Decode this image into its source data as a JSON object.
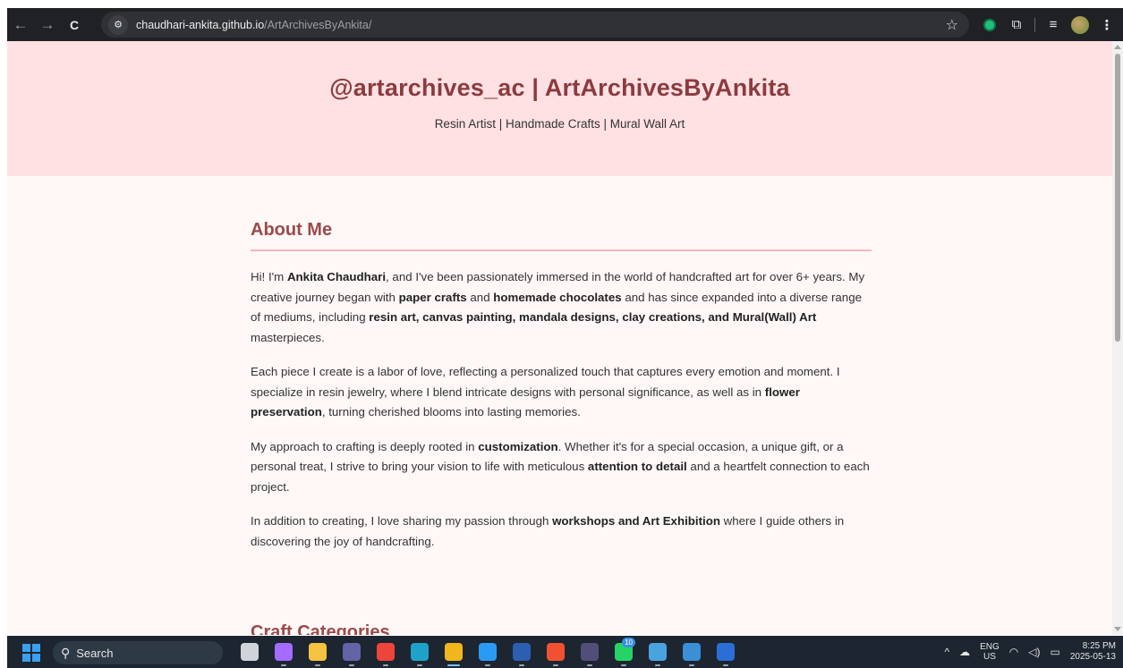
{
  "browser": {
    "back_icon": "←",
    "forward_icon": "→",
    "reload_icon": "C",
    "site_info_icon": "⚙",
    "url_domain": "chaudhari-ankita.github.io",
    "url_path": "/ArtArchivesByAnkita/",
    "star_icon": "☆",
    "extensions_icon": "⧉",
    "media_icon": "≡",
    "menu_icon": "⋮"
  },
  "hero": {
    "title": "@artarchives_ac | ArtArchivesByAnkita",
    "subtitle": "Resin Artist | Handmade Crafts | Mural Wall Art"
  },
  "about": {
    "heading": "About Me",
    "p1": {
      "t1": "Hi! I'm ",
      "b1": "Ankita Chaudhari",
      "t2": ", and I've been passionately immersed in the world of handcrafted art for over 6+ years. My creative journey began with ",
      "b2": "paper crafts",
      "t3": " and ",
      "b3": "homemade chocolates",
      "t4": " and has since expanded into a diverse range of mediums, including ",
      "b4": "resin art, canvas painting, mandala designs, clay creations, and Mural(Wall) Art",
      "t5": " masterpieces."
    },
    "p2": {
      "t1": "Each piece I create is a labor of love, reflecting a personalized touch that captures every emotion and moment. I specialize in resin jewelry, where I blend intricate designs with personal significance, as well as in ",
      "b1": "flower preservation",
      "t2": ", turning cherished blooms into lasting memories."
    },
    "p3": {
      "t1": "My approach to crafting is deeply rooted in ",
      "b1": "customization",
      "t2": ". Whether it's for a special occasion, a unique gift, or a personal treat, I strive to bring your vision to life with meticulous ",
      "b2": "attention to detail",
      "t3": " and a heartfelt connection to each project."
    },
    "p4": {
      "t1": "In addition to creating, I love sharing my passion through ",
      "b1": "workshops and Art Exhibition",
      "t2": " where I guide others in discovering the joy of handcrafting."
    }
  },
  "next_section": {
    "heading": "Craft Categories"
  },
  "taskbar": {
    "search_label": "Search",
    "search_icon": "⚲",
    "apps": [
      {
        "name": "task-view",
        "color": "#d0d4d9"
      },
      {
        "name": "copilot",
        "color": "#a36bff"
      },
      {
        "name": "file-explorer",
        "color": "#f5c242"
      },
      {
        "name": "teams",
        "color": "#6264a7"
      },
      {
        "name": "anydesk",
        "color": "#ef443b"
      },
      {
        "name": "edge",
        "color": "#1fa2c9"
      },
      {
        "name": "chrome",
        "color": "#f0b61b"
      },
      {
        "name": "vscode",
        "color": "#2b9af3"
      },
      {
        "name": "powershell",
        "color": "#2c5fb0"
      },
      {
        "name": "git",
        "color": "#f05133"
      },
      {
        "name": "obs",
        "color": "#514f7a"
      },
      {
        "name": "whatsapp",
        "color": "#25d366",
        "badge": "10"
      },
      {
        "name": "photos",
        "color": "#4aa3df"
      },
      {
        "name": "remote-desktop",
        "color": "#3a8fd6"
      },
      {
        "name": "word",
        "color": "#2b6fd6"
      }
    ],
    "tray": {
      "chevron_icon": "^",
      "onedrive_icon": "☁",
      "lang_top": "ENG",
      "lang_bottom": "US",
      "wifi_icon": "◠",
      "volume_icon": "◁)",
      "battery_icon": "▭",
      "time": "8:25 PM",
      "date": "2025-05-13"
    }
  }
}
